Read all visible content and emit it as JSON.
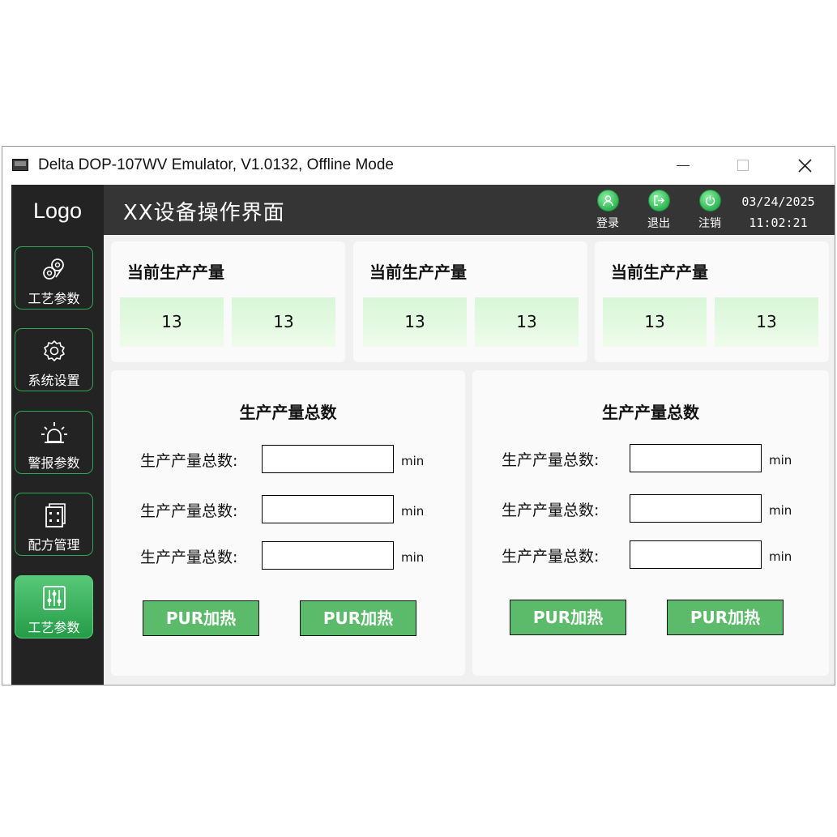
{
  "window": {
    "title": "Delta DOP-107WV Emulator, V1.0132, Offline Mode",
    "controls": [
      "minimize-icon",
      "maximize-icon",
      "close-icon"
    ]
  },
  "colors": {
    "accent_green": "#2fa84f",
    "active_nav_green": "#3fb863",
    "value_cell_green": "#dcf8dc",
    "button_green": "#5cbb6a",
    "header_bg": "#353535",
    "sidebar_bg": "#232323"
  },
  "sidebar": {
    "logo": "Logo",
    "items": [
      {
        "label": "工艺参数",
        "icon": "rollers-icon",
        "active": false
      },
      {
        "label": "系统设置",
        "icon": "gear-icon",
        "active": false
      },
      {
        "label": "警报参数",
        "icon": "alarm-light-icon",
        "active": false
      },
      {
        "label": "配方管理",
        "icon": "recipe-icon",
        "active": false
      },
      {
        "label": "工艺参数",
        "icon": "sliders-icon",
        "active": true
      }
    ]
  },
  "header": {
    "title": "XX设备操作界面",
    "buttons": [
      {
        "label": "登录",
        "icon": "user-icon"
      },
      {
        "label": "退出",
        "icon": "exit-icon"
      },
      {
        "label": "注销",
        "icon": "power-icon"
      }
    ],
    "date": "03/24/2025",
    "time": "11:02:21"
  },
  "production_cards": [
    {
      "title": "当前生产产量",
      "values": [
        "13",
        "13"
      ]
    },
    {
      "title": "当前生产产量",
      "values": [
        "13",
        "13"
      ]
    },
    {
      "title": "当前生产产量",
      "values": [
        "13",
        "13"
      ]
    }
  ],
  "total_panels": [
    {
      "title": "生产产量总数",
      "rows": [
        {
          "label": "生产产量总数:",
          "value": "",
          "unit": "min"
        },
        {
          "label": "生产产量总数:",
          "value": "",
          "unit": "min"
        },
        {
          "label": "生产产量总数:",
          "value": "",
          "unit": "min"
        }
      ],
      "buttons": [
        "PUR加热",
        "PUR加热"
      ]
    },
    {
      "title": "生产产量总数",
      "rows": [
        {
          "label": "生产产量总数:",
          "value": "",
          "unit": "min"
        },
        {
          "label": "生产产量总数:",
          "value": "",
          "unit": "min"
        },
        {
          "label": "生产产量总数:",
          "value": "",
          "unit": "min"
        }
      ],
      "buttons": [
        "PUR加热",
        "PUR加热"
      ]
    }
  ]
}
